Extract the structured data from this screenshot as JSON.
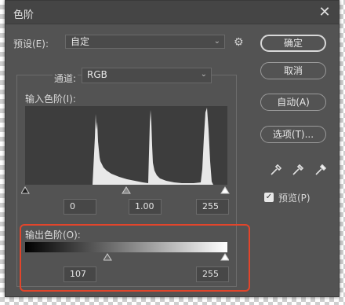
{
  "dialog": {
    "title": "色阶",
    "close_glyph": "✕"
  },
  "preset": {
    "label": "预设(E):",
    "value": "自定",
    "gear_glyph": "⚙"
  },
  "channel": {
    "label": "通道:",
    "value": "RGB"
  },
  "input_levels": {
    "label": "输入色阶(I):",
    "shadow": "0",
    "midtone": "1.00",
    "highlight": "255"
  },
  "output_levels": {
    "label": "输出色阶(O):",
    "low": "107",
    "high": "255"
  },
  "buttons": {
    "ok": "确定",
    "cancel": "取消",
    "auto": "自动(A)",
    "options": "选项(T)..."
  },
  "preview": {
    "label": "预览(P)",
    "checked": true
  },
  "colors": {
    "dialog_bg": "#535353",
    "highlight_box": "#e2452b"
  }
}
